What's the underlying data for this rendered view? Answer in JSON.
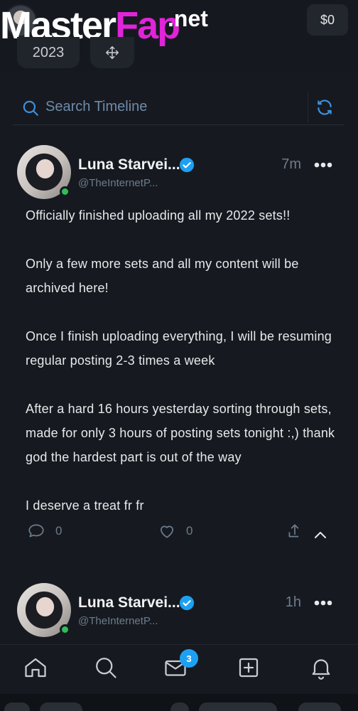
{
  "app": {
    "watermark": {
      "brand_main": "Master",
      "brand_accent": "Fap",
      "brand_suffix": ".net"
    },
    "balance": "$0",
    "year_chip": "2023",
    "move_icon": "move-arrows-icon"
  },
  "search": {
    "placeholder": "Search Timeline",
    "value": "",
    "search_icon": "search-icon",
    "refresh_icon": "refresh-icon"
  },
  "posts": [
    {
      "author_name": "Luna Starvei...",
      "handle": "@TheInternetP...",
      "time": "7m",
      "verified": true,
      "online": true,
      "paragraphs": [
        "Officially finished uploading all my 2022 sets!!",
        "Only a few more sets and all my content will be archived here!",
        "Once I finish uploading everything, I will be resuming regular posting 2-3 times a week",
        "After a hard 16 hours yesterday sorting through sets, made for only 3 hours of posting sets tonight :,) thank god the hardest part is out of the way",
        "I deserve a treat fr fr"
      ],
      "comments": "0",
      "likes": "0"
    },
    {
      "author_name": "Luna Starvei...",
      "handle": "@TheInternetP...",
      "time": "1h",
      "verified": true,
      "online": true
    }
  ],
  "nav": {
    "items": [
      "home-icon",
      "search-icon",
      "messages-icon",
      "add-post-icon",
      "notifications-icon"
    ],
    "messages_badge": "3"
  },
  "colors": {
    "background": "#161a20",
    "accent_blue": "#1ea0f2",
    "watermark_pink": "#e024d8",
    "online_green": "#2fbf57",
    "muted_text": "#6e7c8c"
  }
}
